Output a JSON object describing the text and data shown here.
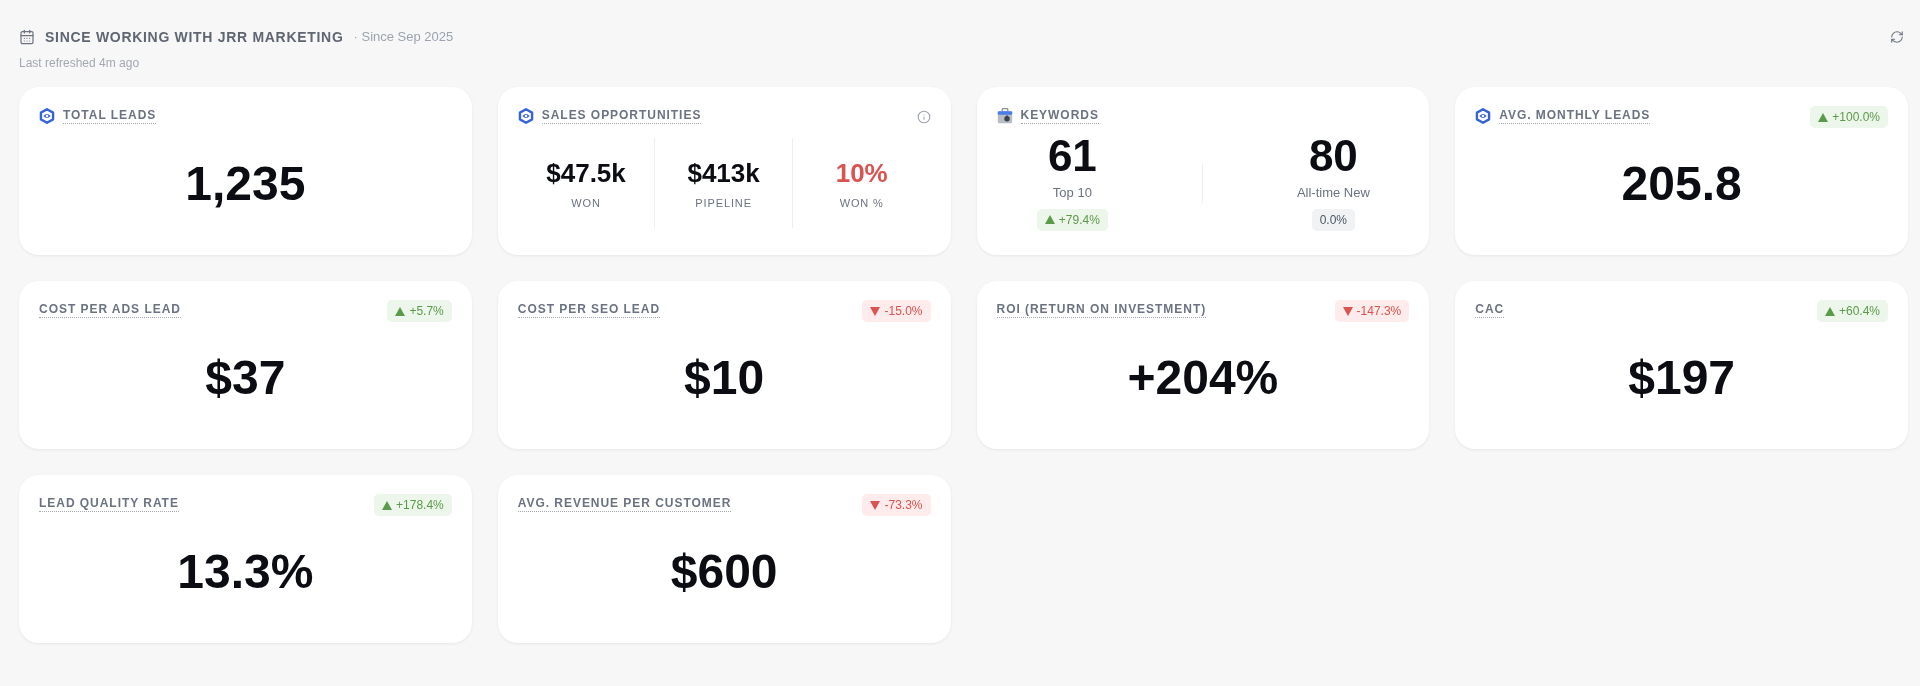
{
  "header": {
    "title": "SINCE WORKING WITH JRR MARKETING",
    "subtitle": "· Since Sep 2025",
    "refreshed": "Last refreshed 4m ago"
  },
  "cards": [
    {
      "kind": "single",
      "title": "TOTAL LEADS",
      "icon": true,
      "value": "1,235"
    },
    {
      "kind": "split",
      "title": "SALES OPPORTUNITIES",
      "icon": true,
      "info": true,
      "metrics": [
        {
          "value": "$47.5k",
          "label": "WON",
          "negative": false
        },
        {
          "value": "$413k",
          "label": "PIPELINE",
          "negative": false
        },
        {
          "value": "10%",
          "label": "WON %",
          "negative": true
        }
      ]
    },
    {
      "kind": "pair",
      "title": "KEYWORDS",
      "icon": true,
      "metrics": [
        {
          "value": "61",
          "label": "Top 10",
          "change": {
            "kind": "up",
            "text": "+79.4%"
          }
        },
        {
          "value": "80",
          "label": "All-time New",
          "change": {
            "kind": "flat",
            "text": "0.0%"
          }
        }
      ]
    },
    {
      "kind": "single",
      "title": "AVG. MONTHLY LEADS",
      "icon": true,
      "value": "205.8",
      "change": {
        "kind": "up",
        "text": "+100.0%"
      }
    },
    {
      "kind": "single",
      "title": "COST PER ADS LEAD",
      "icon": false,
      "value": "$37",
      "change": {
        "kind": "up",
        "text": "+5.7%"
      }
    },
    {
      "kind": "single",
      "title": "COST PER SEO LEAD",
      "icon": false,
      "value": "$10",
      "change": {
        "kind": "down",
        "text": "-15.0%"
      }
    },
    {
      "kind": "single",
      "title": "ROI (RETURN ON INVESTMENT)",
      "icon": false,
      "value": "+204%",
      "change": {
        "kind": "down",
        "text": "-147.3%"
      }
    },
    {
      "kind": "single",
      "title": "CAC",
      "icon": false,
      "value": "$197",
      "change": {
        "kind": "up",
        "text": "+60.4%"
      }
    },
    {
      "kind": "single",
      "title": "LEAD QUALITY RATE",
      "icon": false,
      "value": "13.3%",
      "change": {
        "kind": "up",
        "text": "+178.4%"
      }
    },
    {
      "kind": "single",
      "title": "AVG. REVENUE PER CUSTOMER",
      "icon": false,
      "value": "$600",
      "change": {
        "kind": "down",
        "text": "-73.3%"
      }
    }
  ]
}
